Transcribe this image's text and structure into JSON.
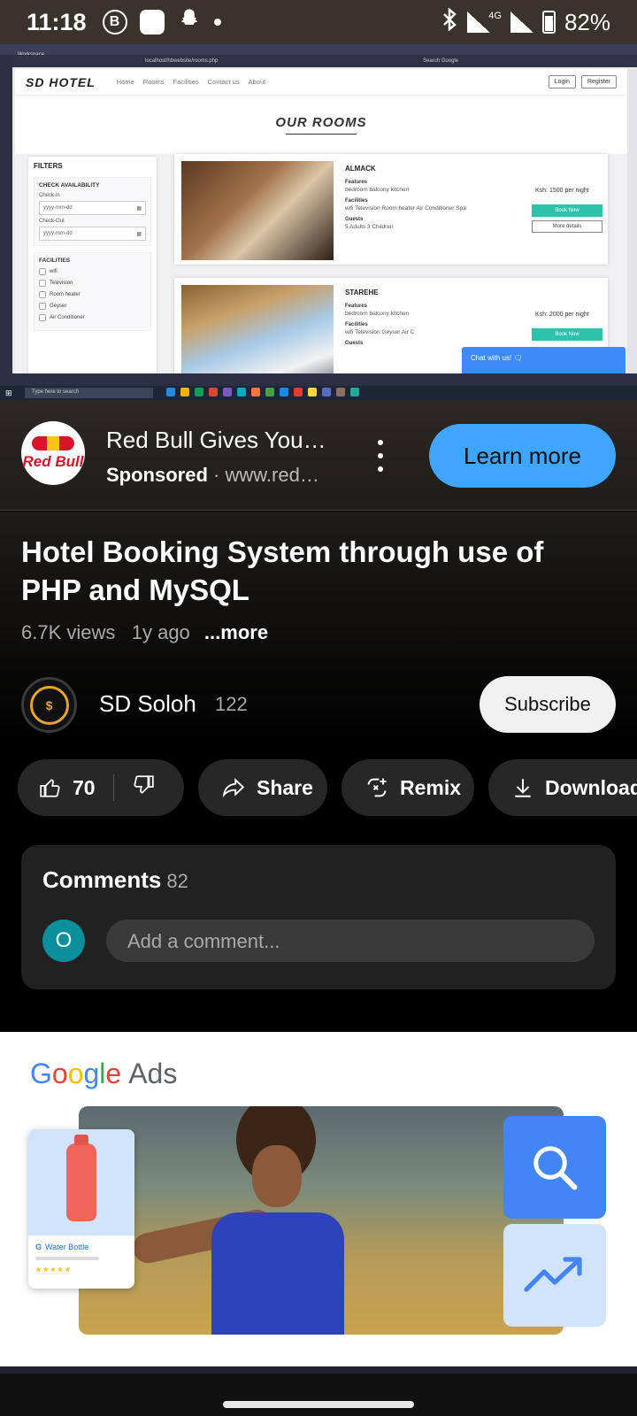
{
  "status_bar": {
    "time": "11:18",
    "network": "4G",
    "battery": "82%",
    "battery_level": 0.82
  },
  "video": {
    "browser_tab": "Workspace",
    "url": "localhost/hbwebsite/rooms.php",
    "browser_search_placeholder": "Search Google",
    "site": {
      "brand": "SD HOTEL",
      "nav": [
        "Home",
        "Rooms",
        "Facilities",
        "Contact us",
        "About"
      ],
      "login": "Login",
      "register": "Register",
      "heading": "OUR ROOMS",
      "filters": {
        "title": "FILTERS",
        "availability_title": "CHECK AVAILABILITY",
        "checkin_label": "Check-in",
        "checkout_label": "Check-Out",
        "date_placeholder": "yyyy-mm-dd",
        "facilities_title": "FACILITIES",
        "facilities": [
          "wifi",
          "Television",
          "Room heater",
          "Geyser",
          "Air Conditioner"
        ]
      },
      "rooms": [
        {
          "name": "ALMACK",
          "features_label": "Features",
          "features": "bedroom  balcony  kitchen",
          "facilities_label": "Facilities",
          "facilities": "wifi  Television  Room heater  Air Conditioner  Spa",
          "guests_label": "Guests",
          "guests": "5 Adults 3 Children",
          "price": "Ksh: 1500 per night",
          "book": "Book Now",
          "details": "More details"
        },
        {
          "name": "STAREHE",
          "features_label": "Features",
          "features": "bedroom  balcony  kitchen",
          "facilities_label": "Facilities",
          "facilities": "wifi  Television  Geyser  Air C",
          "guests_label": "Guests",
          "price": "Ksh: 2000 per night",
          "book": "Book Now"
        }
      ],
      "chat": "Chat with us! 🗨"
    },
    "taskbar_search": "Type here to search"
  },
  "ad": {
    "logo_text": "Red Bull",
    "title": "Red Bull Gives You…",
    "sponsored": "Sponsored",
    "url": "· www.red…",
    "cta": "Learn more"
  },
  "video_info": {
    "title": "Hotel Booking System through use of PHP and MySQL",
    "views": "6.7K views",
    "age": "1y ago",
    "more": "...more"
  },
  "channel": {
    "name": "SD Soloh",
    "subscribers": "122",
    "subscribe": "Subscribe"
  },
  "actions": {
    "likes": "70",
    "share": "Share",
    "remix": "Remix",
    "download": "Download"
  },
  "comments": {
    "title": "Comments",
    "count": "82",
    "avatar_initial": "O",
    "placeholder": "Add a comment..."
  },
  "google_ads": {
    "brand_letters": [
      "G",
      "o",
      "o",
      "g",
      "l",
      "e"
    ],
    "product": "Ads",
    "product_card_name": "Water Bottle",
    "product_card_g": "G",
    "stars": "★★★★★"
  },
  "colors": {
    "accent_blue": "#3ea6ff",
    "comment_avatar": "#0a8f9c",
    "book_button": "#2ec1ac"
  }
}
